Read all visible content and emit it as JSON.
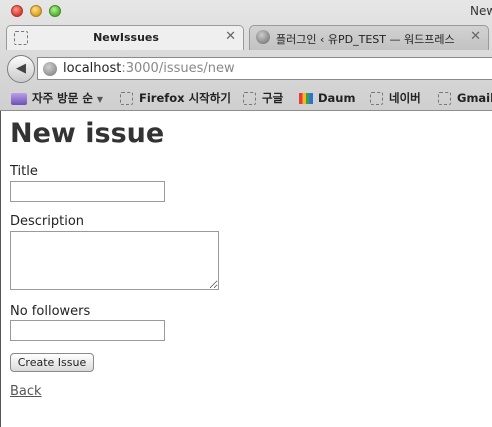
{
  "window": {
    "title": "New"
  },
  "tabs": [
    {
      "label": "NewIssues",
      "active": true
    },
    {
      "label": "플러그인 ‹ 유PD_TEST — 워드프레스",
      "active": false
    }
  ],
  "address_bar": {
    "host": "localhost",
    "path": ":3000/issues/new"
  },
  "bookmarks": [
    {
      "label": "자주 방문 순",
      "icon": "folder-icon"
    },
    {
      "label": "Firefox 시작하기",
      "icon": "bookmark-icon"
    },
    {
      "label": "구글",
      "icon": "bookmark-icon"
    },
    {
      "label": "Daum",
      "icon": "daum-icon"
    },
    {
      "label": "네이버",
      "icon": "bookmark-icon"
    },
    {
      "label": "Gmail",
      "icon": "bookmark-icon"
    }
  ],
  "page": {
    "heading": "New issue",
    "form": {
      "title_label": "Title",
      "title_value": "",
      "description_label": "Description",
      "description_value": "",
      "followers_label": "No followers",
      "followers_value": "",
      "submit_label": "Create Issue"
    },
    "back_link": "Back"
  }
}
